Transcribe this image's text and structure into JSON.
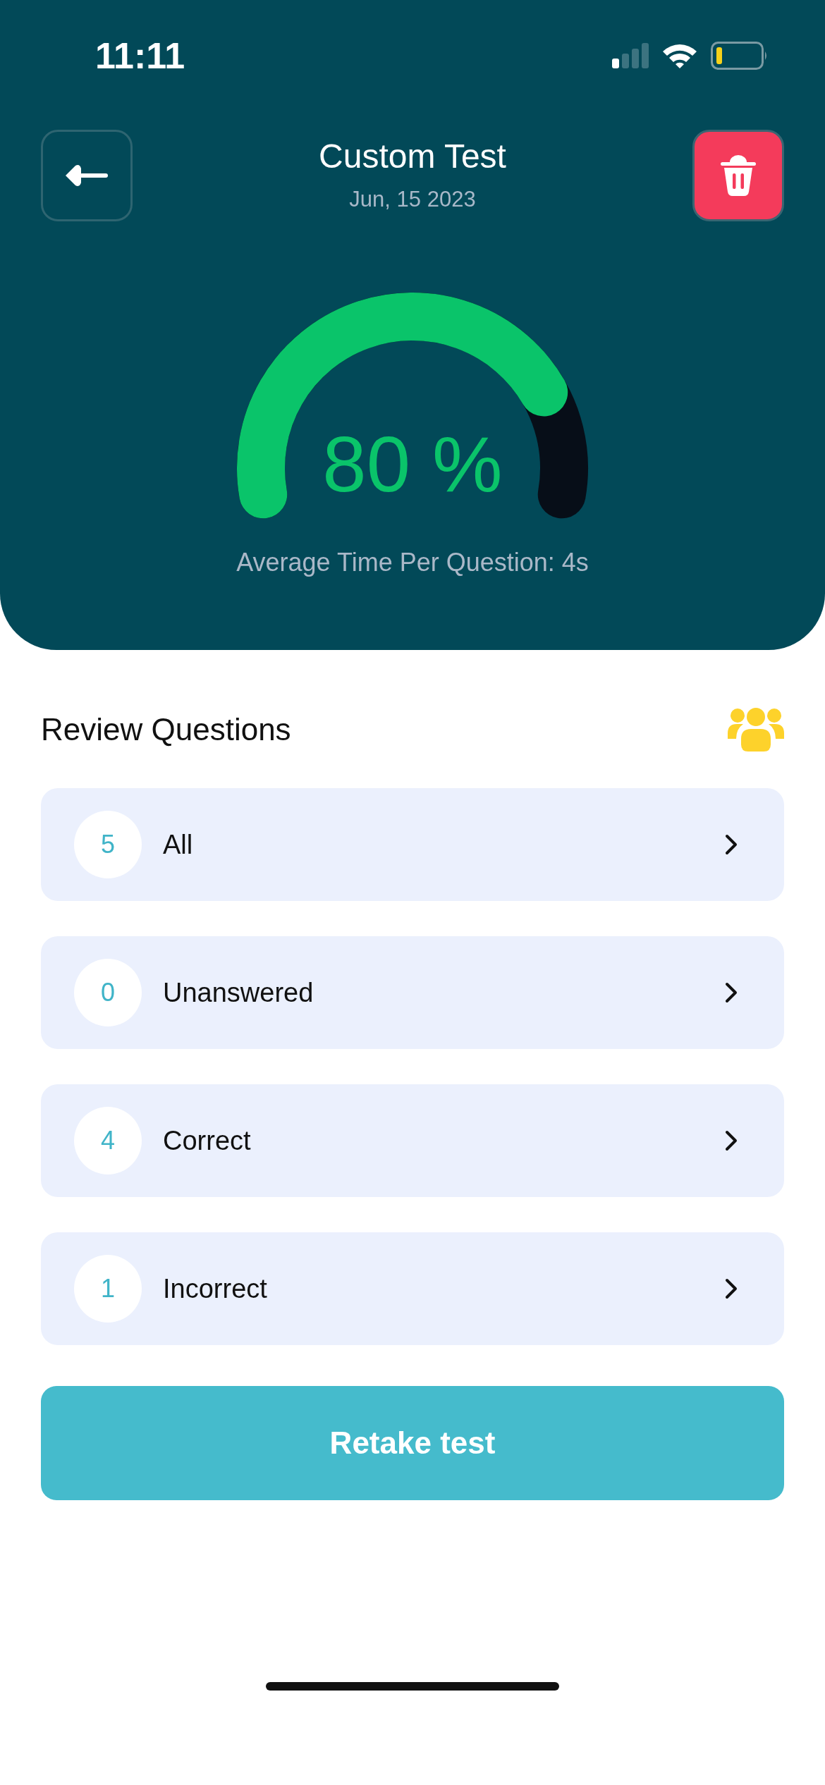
{
  "status_bar": {
    "time": "11:11"
  },
  "header": {
    "title": "Custom Test",
    "date": "Jun, 15 2023"
  },
  "gauge": {
    "reading": "80 %",
    "caption": "Average Time Per Question: 4s"
  },
  "review": {
    "title": "Review Questions",
    "items": [
      {
        "count": "5",
        "label": "All"
      },
      {
        "count": "0",
        "label": "Unanswered"
      },
      {
        "count": "4",
        "label": "Correct"
      },
      {
        "count": "1",
        "label": "Incorrect"
      }
    ]
  },
  "retake_button": "Retake test"
}
